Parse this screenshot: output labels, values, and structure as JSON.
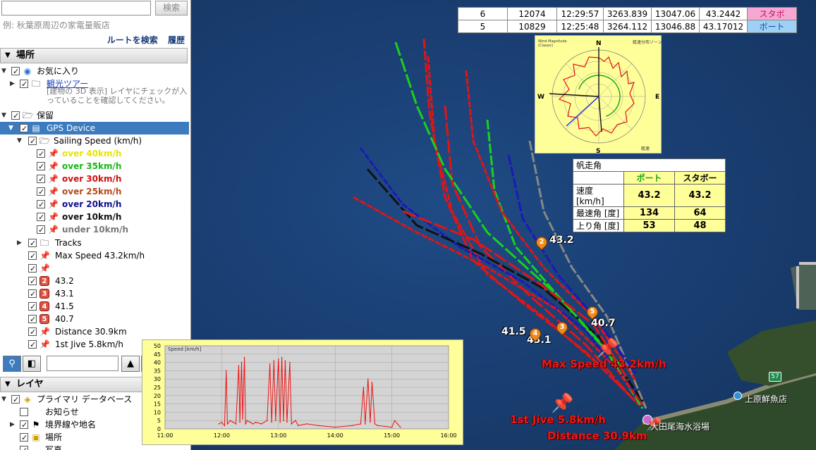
{
  "search": {
    "value": "",
    "button_label": "検索",
    "hint": "例: 秋葉原周辺の家電量販店",
    "route_link": "ルートを検索",
    "history_link": "履歴"
  },
  "places_panel": {
    "title": "場所",
    "favorites": "お気に入り",
    "tour": "観光ツアー",
    "note": "[建物の 3D 表示] レイヤにチェックが入っていることを確認してください。",
    "pending": "保留",
    "gps_device": "GPS Device",
    "sailing_speed": "Sailing Speed (km/h)",
    "speed_items": [
      {
        "label": "over 40km/h",
        "color": "#e6e600"
      },
      {
        "label": "over 35km/h",
        "color": "#15b915"
      },
      {
        "label": "over 30km/h",
        "color": "#d01010"
      },
      {
        "label": "over 25km/h",
        "color": "#b34a1a"
      },
      {
        "label": "over 20km/h",
        "color": "#10108a"
      },
      {
        "label": "over 10km/h",
        "color": "#111111"
      },
      {
        "label": "under 10km/h",
        "color": "#777777"
      }
    ],
    "tracks": "Tracks",
    "max_speed": "Max Speed 43.2km/h",
    "numbered": [
      {
        "num": "2",
        "label": "43.2"
      },
      {
        "num": "3",
        "label": "43.1"
      },
      {
        "num": "4",
        "label": "41.5"
      },
      {
        "num": "5",
        "label": "40.7"
      }
    ],
    "distance": "Distance 30.9km",
    "first_jive": "1st Jive 5.8km/h"
  },
  "layers_panel": {
    "title": "レイヤ",
    "primary_db": "プライマリ データベース",
    "notice": "お知らせ",
    "borders": "境界線や地名",
    "places": "場所",
    "photos": "写真"
  },
  "top_table": {
    "rows": [
      [
        "6",
        "12074",
        "12:29:57",
        "3263.839",
        "13047.06",
        "43.2442",
        "スタボ"
      ],
      [
        "5",
        "10829",
        "12:25:48",
        "3264.112",
        "13046.88",
        "43.17012",
        "ボート"
      ]
    ]
  },
  "polar": {
    "legend_1": "Wind Magnitude",
    "legend_2": "(Classic)",
    "header_right": "艇速分布ゾーン",
    "north": "N",
    "south": "S",
    "east": "E",
    "west": "W",
    "footer_right": "艇速"
  },
  "sail_table": {
    "title": "帆走角",
    "col_port": "ポート",
    "col_stbd": "スタボー",
    "rows": [
      {
        "label": "速度 [km/h]",
        "port": "43.2",
        "stbd": "43.2"
      },
      {
        "label": "最速角 [度]",
        "port": "134",
        "stbd": "64"
      },
      {
        "label": "上り角 [度]",
        "port": "53",
        "stbd": "48"
      }
    ]
  },
  "map_labels": {
    "m2": "43.2",
    "m3": "43.1",
    "m4": "41.5",
    "m5": "40.7",
    "max_speed": "Max Speed 43.2km/h",
    "first_jive": "1st Jive 5.8km/h",
    "distance": "Distance 30.9km",
    "beach": "大田尾海水浴場",
    "fish_shop": "上原鮮魚店",
    "route_num": "57"
  },
  "chart_data": {
    "type": "line",
    "legend": "Speed [km/h]",
    "x_ticks": [
      "11:00",
      "12:00",
      "13:00",
      "14:00",
      "15:00",
      "16:00"
    ],
    "y_ticks": [
      "0",
      "5",
      "10",
      "15",
      "20",
      "25",
      "30",
      "35",
      "40",
      "45",
      "50"
    ],
    "ylim": [
      0,
      50
    ],
    "series": [
      {
        "color": "#ee1111",
        "points": [
          [
            11.95,
            3
          ],
          [
            12.0,
            4
          ],
          [
            12.05,
            2
          ],
          [
            12.08,
            35
          ],
          [
            12.1,
            3
          ],
          [
            12.15,
            5
          ],
          [
            12.2,
            4
          ],
          [
            12.25,
            3
          ],
          [
            12.3,
            38
          ],
          [
            12.32,
            4
          ],
          [
            12.35,
            40
          ],
          [
            12.37,
            6
          ],
          [
            12.4,
            43
          ],
          [
            12.42,
            3
          ],
          [
            12.45,
            5
          ],
          [
            12.5,
            4
          ],
          [
            12.55,
            3
          ],
          [
            12.6,
            4
          ],
          [
            12.7,
            3
          ],
          [
            12.8,
            5
          ],
          [
            12.85,
            39
          ],
          [
            12.88,
            4
          ],
          [
            12.92,
            41
          ],
          [
            12.95,
            5
          ],
          [
            13.0,
            42
          ],
          [
            13.03,
            4
          ],
          [
            13.06,
            43
          ],
          [
            13.09,
            5
          ],
          [
            13.12,
            41
          ],
          [
            13.15,
            4
          ],
          [
            13.2,
            40
          ],
          [
            13.23,
            3
          ],
          [
            13.3,
            5
          ],
          [
            13.35,
            2
          ],
          [
            13.5,
            3
          ],
          [
            13.7,
            2
          ],
          [
            14.0,
            1
          ],
          [
            14.3,
            2
          ],
          [
            14.45,
            3
          ],
          [
            14.5,
            25
          ],
          [
            14.53,
            3
          ],
          [
            14.58,
            30
          ],
          [
            14.62,
            4
          ],
          [
            14.65,
            28
          ],
          [
            14.7,
            3
          ],
          [
            14.75,
            2
          ],
          [
            15.0,
            1
          ],
          [
            15.05,
            5
          ],
          [
            15.1,
            3
          ],
          [
            15.15,
            1
          ]
        ]
      }
    ]
  }
}
